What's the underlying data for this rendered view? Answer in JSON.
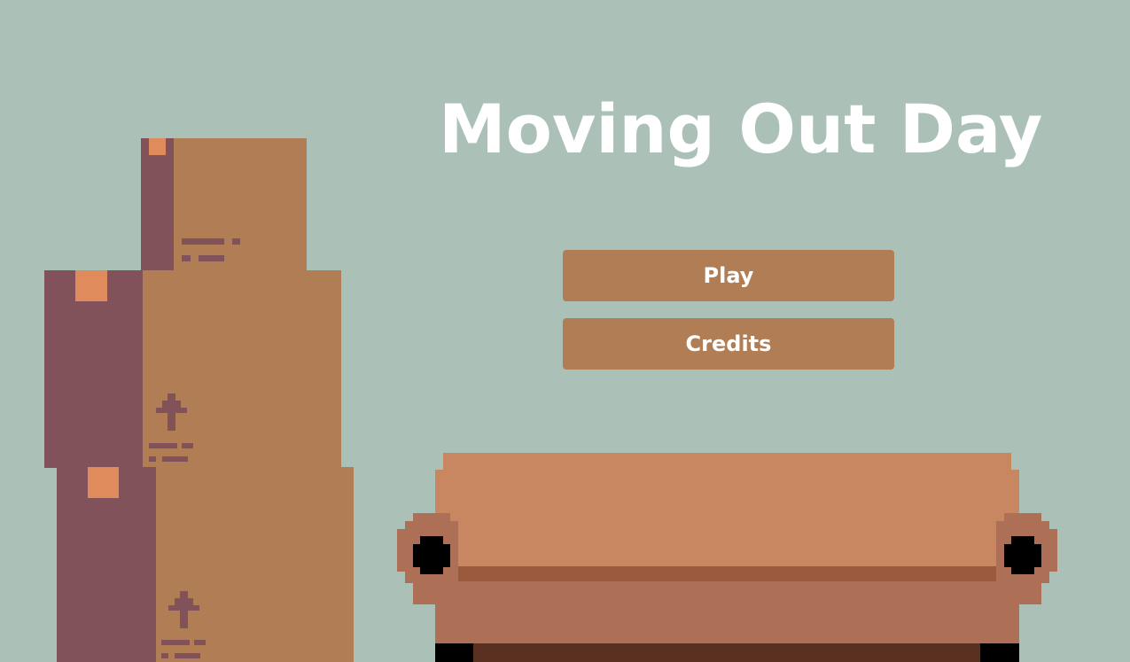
{
  "game": {
    "title": "Moving Out Day"
  },
  "menu": {
    "play_label": "Play",
    "credits_label": "Credits"
  },
  "colors": {
    "background": "#abc0b7",
    "button": "#b17d55",
    "button_text": "#ffffff",
    "box_front": "#b17d55",
    "box_side": "#82525b",
    "box_tape": "#df8b5c",
    "sofa_top": "#c88760",
    "sofa_front": "#ad6f55"
  }
}
